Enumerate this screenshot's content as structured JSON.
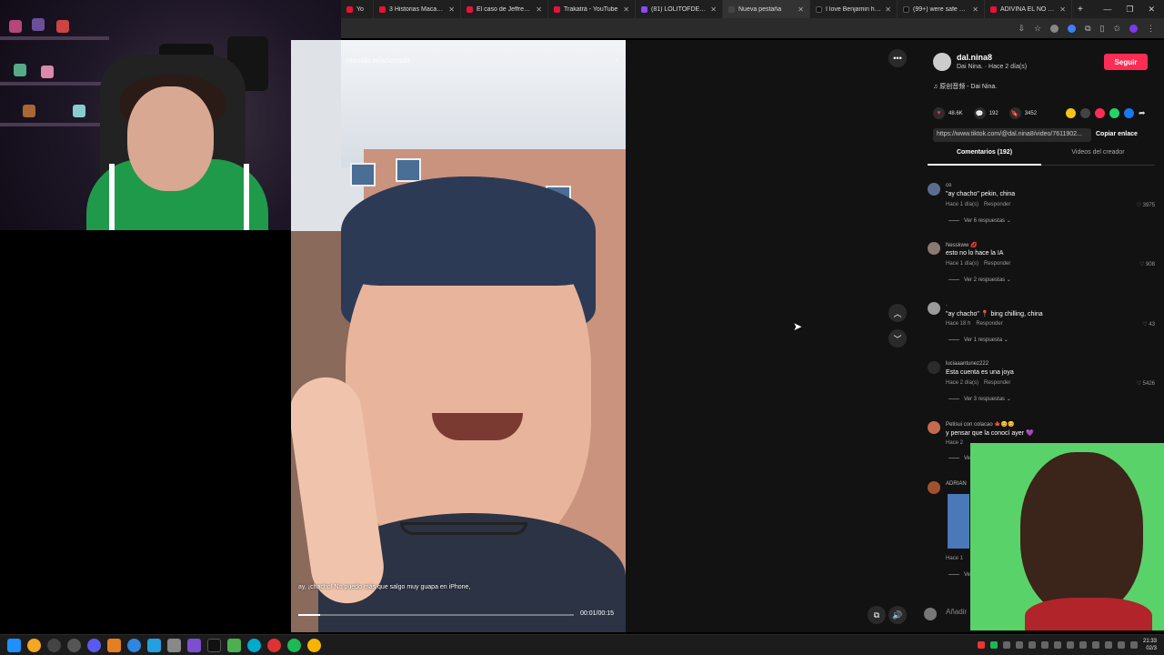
{
  "browser": {
    "tabs": [
      {
        "title": "Yo",
        "color": "#e8113a"
      },
      {
        "title": "3 Historias Macabras",
        "color": "#e8113a"
      },
      {
        "title": "El caso de Jeffrey Epst",
        "color": "#e8113a"
      },
      {
        "title": "Trakatrá - YouTube",
        "color": "#e8113a"
      },
      {
        "title": "(81) LOLITOFDEZ - Twi",
        "color": "#9146ff"
      },
      {
        "title": "Nueva pestaña",
        "color": "#444444"
      },
      {
        "title": "I love Benjamin he is a",
        "color": "#111111"
      },
      {
        "title": "(99+) were safe guys",
        "color": "#111111"
      },
      {
        "title": "ADIVINA EL NO FUMA",
        "color": "#e8113a"
      }
    ],
    "new_tab": "+",
    "minimize": "—",
    "maximize": "❐",
    "close": "✕"
  },
  "video": {
    "search_placeholder": "ntenido relacionado",
    "subtitle": "ay, ¡chacho! No puedo más que salgo muy guapa en iPhone,",
    "timecode": "00:01/00:15",
    "progress": 0.08
  },
  "post": {
    "username": "dal.nina8",
    "subline": "Dai Nina. · Hace 2 día(s)",
    "follow_label": "Seguir",
    "sound": "♫ 原创音频 - Dai Nina.",
    "likes": "48.6K",
    "comments_count": "192",
    "saves": "3452",
    "link": "https://www.tiktok.com/@dal.nina8/video/7611902...",
    "copy_label": "Copiar enlace",
    "tab_comments": "Comentarios (192)",
    "tab_creator": "Videos del creador",
    "add_comment": "Añadir"
  },
  "comments": [
    {
      "user": "co",
      "text": "\"ay chacho\" pekin, china",
      "time": "Hace 1 día(s)",
      "reply": "Responder",
      "likes": "3975",
      "replies": "Ver 6 respuestas ⌄",
      "avatar": "#5b6d8c"
    },
    {
      "user": "Nesskww 💋",
      "text": "esto no lo hace la IA",
      "time": "Hace 1 día(s)",
      "reply": "Responder",
      "likes": "908",
      "replies": "Ver 2 respuestas ⌄",
      "avatar": "#8a7a70"
    },
    {
      "user": ".",
      "text": "\"ay chacho\" 📍 bing chilling, china",
      "time": "Hace 18 h",
      "reply": "Responder",
      "likes": "43",
      "replies": "Ver 1 respuesta ⌄",
      "avatar": "#9a9a9a"
    },
    {
      "user": "luciaaantunez222",
      "text": "Esta cuenta es una joya",
      "time": "Hace 2 día(s)",
      "reply": "Responder",
      "likes": "5426",
      "replies": "Ver 3 respuestas ⌄",
      "avatar": "#2b2b2b"
    },
    {
      "user": "Petisui con colacao 🍁😊😊",
      "text": "y pensar que la conocí ayer 💜",
      "time": "Hace 2",
      "reply": "",
      "likes": "",
      "replies": "Ve",
      "avatar": "#c56a4f"
    },
    {
      "user": "ADRIAN",
      "text": "",
      "time": "Hace 1",
      "reply": "",
      "likes": "",
      "replies": "Ve",
      "avatar": "#a0522d"
    }
  ],
  "taskbar": {
    "time": "21:33",
    "date": "02/3"
  },
  "colors": {
    "accent": "#fe2c55",
    "like": "#fe2c55",
    "panel_bg": "#121212"
  }
}
